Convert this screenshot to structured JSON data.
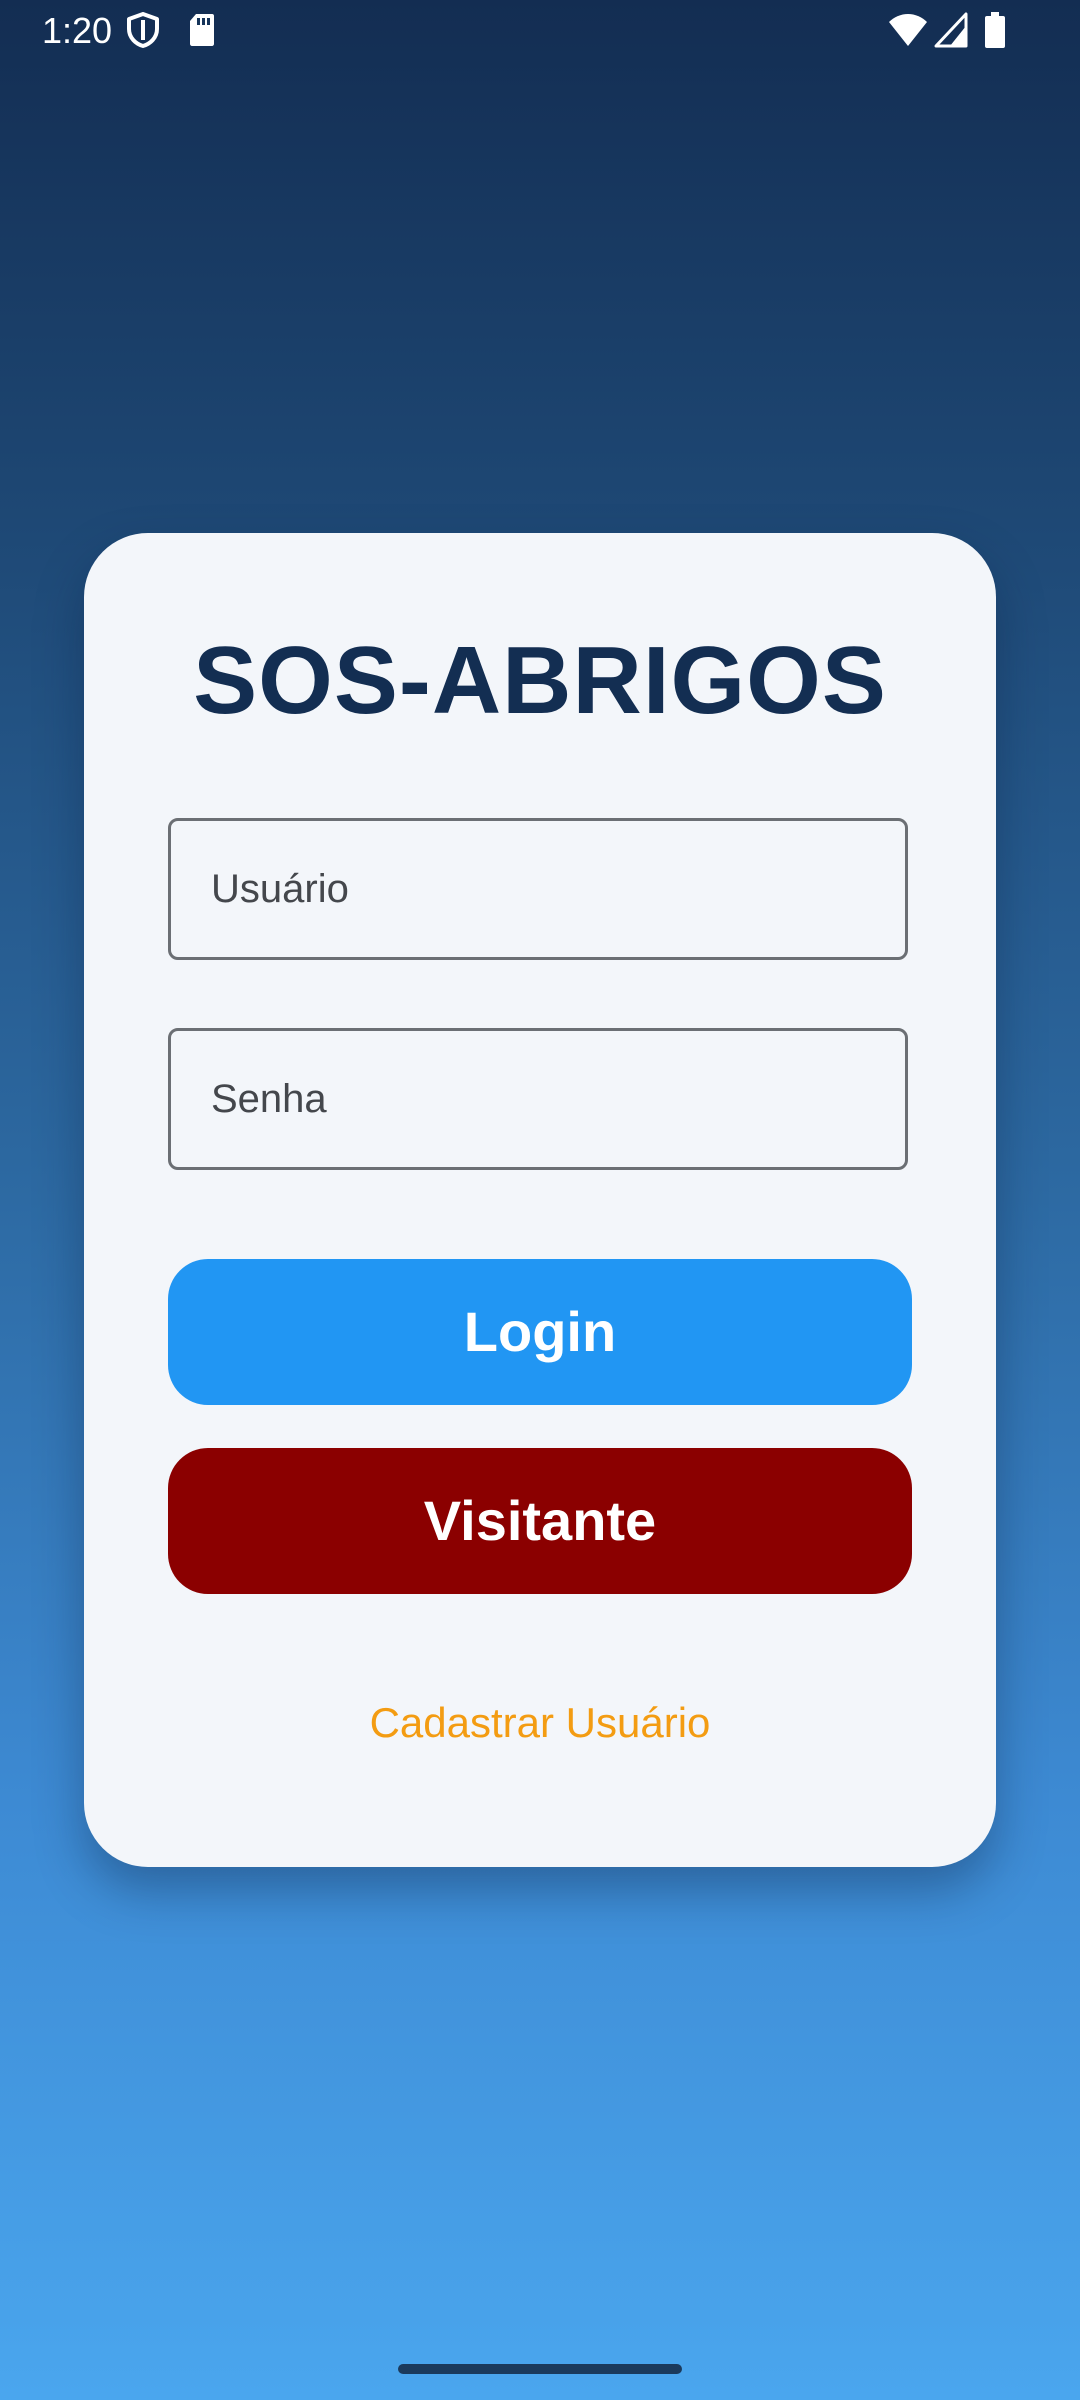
{
  "status_bar": {
    "time": "1:20",
    "left_icons": [
      "shield-icon",
      "sd-card-icon"
    ],
    "right_icons": [
      "wifi-icon",
      "signal-icon",
      "battery-icon"
    ]
  },
  "login_card": {
    "title": "SOS-ABRIGOS",
    "username_placeholder": "Usuário",
    "password_placeholder": "Senha",
    "login_label": "Login",
    "visitor_label": "Visitante",
    "register_label": "Cadastrar Usuário"
  },
  "colors": {
    "title": "#132e52",
    "login_button": "#2196f3",
    "visitor_button": "#8b0000",
    "register_link": "#f39c12",
    "card_background": "#f3f6fa"
  }
}
